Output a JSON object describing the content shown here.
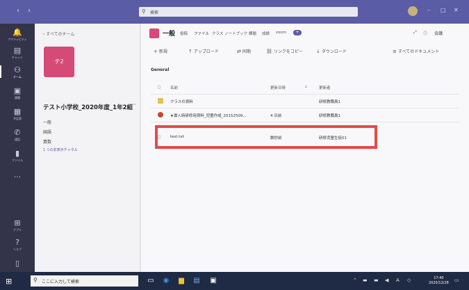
{
  "titlebar": {
    "search_placeholder": "検索",
    "back": "‹",
    "forward": "›",
    "minimize": "–",
    "maximize": "□",
    "close": "✕"
  },
  "rail": [
    {
      "label": "アクティビティ",
      "icon": "bell-icon",
      "glyph": "🔔"
    },
    {
      "label": "チャット",
      "icon": "chat-icon",
      "glyph": "▤"
    },
    {
      "label": "チーム",
      "icon": "teams-icon",
      "glyph": "⚇"
    },
    {
      "label": "課題",
      "icon": "assignments-icon",
      "glyph": "▣"
    },
    {
      "label": "予定表",
      "icon": "calendar-icon",
      "glyph": "▦"
    },
    {
      "label": "通話",
      "icon": "phone-icon",
      "glyph": "✆"
    },
    {
      "label": "ファイル",
      "icon": "files-icon",
      "glyph": "▮"
    },
    {
      "label": "",
      "icon": "more-icon",
      "glyph": "···"
    },
    {
      "label": "アプリ",
      "icon": "apps-icon",
      "glyph": "⊞"
    },
    {
      "label": "ヘルプ",
      "icon": "help-icon",
      "glyph": "?"
    },
    {
      "label": "",
      "icon": "device-icon",
      "glyph": "▯"
    }
  ],
  "sidebar": {
    "back_label": "‹ すべてのチーム",
    "team_tile_text": "テ2",
    "team_name": "テスト小学校_2020年度_1年2組",
    "more": "···",
    "channels": [
      "一般",
      "国語",
      "算数"
    ],
    "hidden_channels": "1 つの非表示チャネル"
  },
  "main": {
    "channel_title": "一般",
    "tabs": [
      "投稿",
      "ファイル",
      "クラス ノートブック",
      "課題",
      "成績",
      "zoom"
    ],
    "active_tab_index": 1,
    "add_tab": "+",
    "head_right": [
      "⤢",
      "ⓘ",
      "会議"
    ],
    "toolbar": [
      {
        "icon": "+",
        "label": "新規"
      },
      {
        "icon": "↑",
        "label": "アップロード"
      },
      {
        "icon": "⇄",
        "label": "同期"
      },
      {
        "icon": "⛓",
        "label": "リンクをコピー"
      },
      {
        "icon": "↓",
        "label": "ダウンロード"
      },
      {
        "icon": "≡",
        "label": "すべてのドキュメント"
      }
    ],
    "section": "General",
    "files_header": {
      "name": "名前",
      "date": "更新日時",
      "by": "更新者",
      "sort": "↓"
    },
    "files": [
      {
        "type": "folder",
        "name": "クラスの資料",
        "date": "",
        "by": "研修教職員1"
      },
      {
        "type": "ppt",
        "name": "★導入時研修用資料_児童作成_20152509...",
        "date": "4 日前",
        "by": "研修教職員1"
      },
      {
        "type": "txt",
        "name": "test.txt",
        "date": "数秒前",
        "by": "研修児童生徒01"
      }
    ]
  },
  "taskbar": {
    "search_placeholder": "ここに入力して検索",
    "clock_time": "17:40",
    "clock_date": "2020/12/28"
  },
  "colors": {
    "teams_purple": "#5a5ca6",
    "rail_dark": "#33344a",
    "team_pink": "#d64a78",
    "highlight_red": "#e24b4b"
  }
}
